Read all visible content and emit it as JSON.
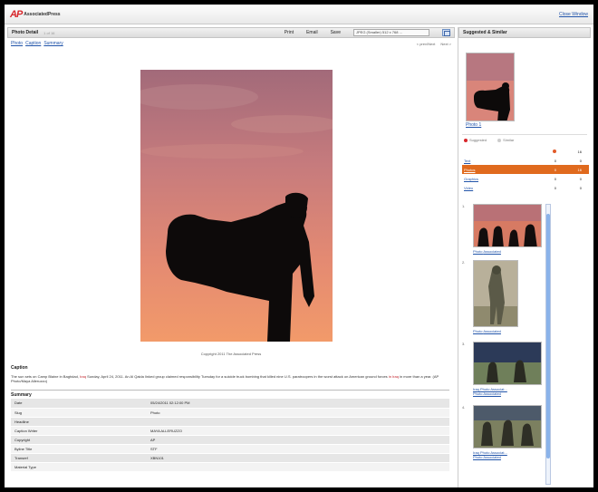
{
  "header": {
    "logo_mark": "AP",
    "logo_text": "AssociatedPress",
    "close_link": "Close Window"
  },
  "detail": {
    "panel_title": "Photo Detail",
    "panel_sub": "1 of 16",
    "toolbar": {
      "print": "Print",
      "email": "Email",
      "save": "Save",
      "select_value": "JPEG (Smaller) 512 x 768 ..."
    },
    "tabs": [
      "Photo",
      "Caption",
      "Summary"
    ],
    "nav": {
      "prev": "< prev/Next",
      "next": "Next >"
    },
    "copyright": "Copyright 2011 The Associated Press",
    "caption_heading": "Caption",
    "caption": {
      "part1": "The sun sets on Camp Blaine in Baghdad,",
      "place": "Iraq",
      "part2": "Sunday, April 24, 2011. An Al Qaida linked group claimed responsibility Tuesday for a suicide truck bombing that killed nine U.S. paratroopers in the worst attack on American ground forces",
      "highlight": "in Iraq",
      "part3": "in more than a year. (AP Photo/Maya Alleruzzo)"
    },
    "summary_heading": "Summary",
    "summary": [
      {
        "key": "Date",
        "value": "05/24/2011 02:12:00 PM"
      },
      {
        "key": "Slug",
        "value": "Photo"
      },
      {
        "key": "Headline",
        "value": ""
      },
      {
        "key": "Caption Writer",
        "value": "MAYA ALLERUZZO"
      },
      {
        "key": "Copyright",
        "value": "AP"
      },
      {
        "key": "Byline Title",
        "value": "STF"
      },
      {
        "key": "Transref",
        "value": "XBN101"
      },
      {
        "key": "Material Type",
        "value": ""
      }
    ]
  },
  "sidebar": {
    "title": "Suggested & Similar",
    "thumb_label": "Photo 1",
    "options": [
      "Suggested",
      "Similar"
    ],
    "category_header_count": "16",
    "categories": [
      {
        "label": "Text",
        "a": "0",
        "b": "0"
      },
      {
        "label": "Photos",
        "a": "0",
        "b": "16"
      },
      {
        "label": "Graphics",
        "a": "0",
        "b": "0"
      },
      {
        "label": "Video",
        "a": "0",
        "b": "0"
      }
    ],
    "results": [
      {
        "num": "1.",
        "line1": "Photo",
        "line2": "Associated"
      },
      {
        "num": "2.",
        "line1": "Photo",
        "line2": "Associated"
      },
      {
        "num": "3.",
        "line1": "Iraq Photo Associat...",
        "line2": "Photo Associated"
      },
      {
        "num": "4.",
        "line1": "Iraq Photo Associat...",
        "line2": "Photo Associated"
      }
    ]
  },
  "colors": {
    "accent": "#e06a1e",
    "link": "#2255aa",
    "brand": "#d8262b"
  }
}
